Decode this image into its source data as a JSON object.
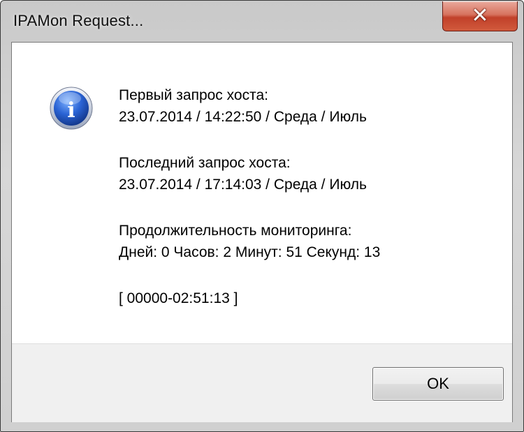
{
  "window": {
    "title": "IPAMon  Request...",
    "close_glyph": "✕"
  },
  "icon": {
    "name": "info-icon",
    "glyph": "i",
    "color": "#1f4fb8"
  },
  "message": {
    "first_label": "Первый запрос хоста:",
    "first_value": "23.07.2014 / 14:22:50 / Среда / Июль",
    "last_label": "Последний запрос хоста:",
    "last_value": "23.07.2014 / 17:14:03 / Среда / Июль",
    "duration_label": "Продолжительность мониторинга:",
    "duration_value": "Дней: 0  Часов: 2  Минут: 51  Секунд: 13",
    "code": "[ 00000-02:51:13 ]"
  },
  "buttons": {
    "ok_label": "OK"
  }
}
